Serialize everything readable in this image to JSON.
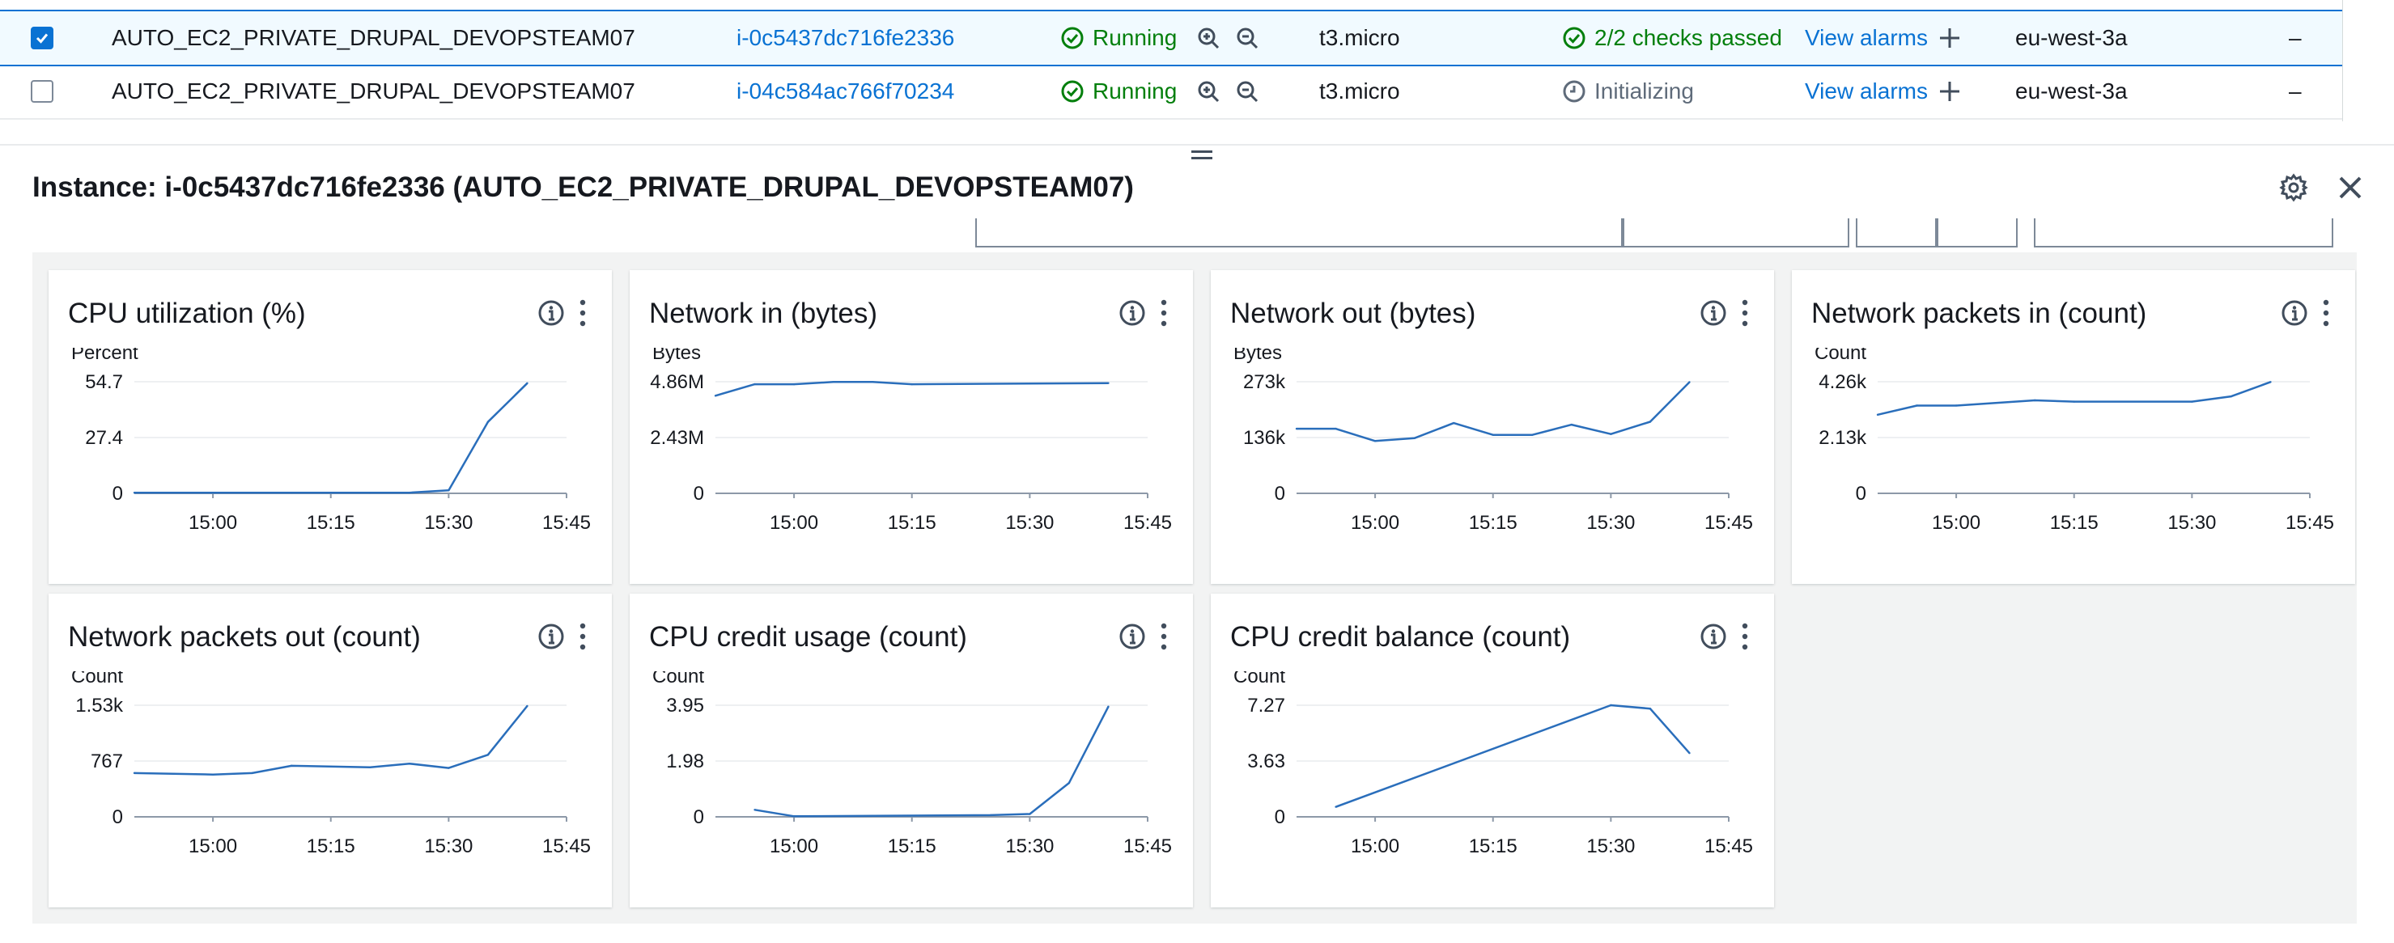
{
  "instances": [
    {
      "selected": true,
      "name": "AUTO_EC2_PRIVATE_DRUPAL_DEVOPSTEAM07",
      "id": "i-0c5437dc716fe2336",
      "state": "Running",
      "type": "t3.micro",
      "status_check": "2/2 checks passed",
      "status_kind": "ok",
      "alarm": "View alarms",
      "az": "eu-west-3a",
      "ip": "–"
    },
    {
      "selected": false,
      "name": "AUTO_EC2_PRIVATE_DRUPAL_DEVOPSTEAM07",
      "id": "i-04c584ac766f70234",
      "state": "Running",
      "type": "t3.micro",
      "status_check": "Initializing",
      "status_kind": "init",
      "alarm": "View alarms",
      "az": "eu-west-3a",
      "ip": "–"
    }
  ],
  "panel": {
    "title": "Instance: i-0c5437dc716fe2336 (AUTO_EC2_PRIVATE_DRUPAL_DEVOPSTEAM07)",
    "icons": [
      "gear-icon",
      "close-icon",
      "info-icon",
      "more-vertical-icon",
      "zoom-in-icon",
      "zoom-out-icon",
      "check-circle-icon",
      "clock-icon",
      "plus-icon"
    ]
  },
  "colors": {
    "link": "#0972d3",
    "success": "#037f0c",
    "line": "#2a6ebb",
    "pending": "#5f6b7a"
  },
  "chart_data": [
    {
      "type": "line",
      "title": "CPU utilization (%)",
      "ylabel": "Percent",
      "xticks": [
        "15:00",
        "15:15",
        "15:30",
        "15:45"
      ],
      "yticks": [
        "0",
        "27.4",
        "54.7"
      ],
      "ylim": [
        0,
        54.7
      ],
      "x": [
        "14:50",
        "15:00",
        "15:10",
        "15:20",
        "15:25",
        "15:30",
        "15:35",
        "15:40"
      ],
      "values": [
        0.3,
        0.3,
        0.3,
        0.3,
        0.3,
        1.5,
        35,
        54
      ]
    },
    {
      "type": "line",
      "title": "Network in (bytes)",
      "ylabel": "Bytes",
      "xticks": [
        "15:00",
        "15:15",
        "15:30",
        "15:45"
      ],
      "yticks": [
        "0",
        "2.43M",
        "4.86M"
      ],
      "ylim": [
        0,
        4.86
      ],
      "x": [
        "14:50",
        "14:55",
        "15:00",
        "15:05",
        "15:10",
        "15:15",
        "15:40"
      ],
      "values": [
        4.25,
        4.75,
        4.75,
        4.85,
        4.85,
        4.75,
        4.8
      ]
    },
    {
      "type": "line",
      "title": "Network out (bytes)",
      "ylabel": "Bytes",
      "xticks": [
        "15:00",
        "15:15",
        "15:30",
        "15:45"
      ],
      "yticks": [
        "0",
        "136k",
        "273k"
      ],
      "ylim": [
        0,
        273
      ],
      "x": [
        "14:50",
        "14:55",
        "15:00",
        "15:05",
        "15:10",
        "15:15",
        "15:20",
        "15:25",
        "15:30",
        "15:35",
        "15:40"
      ],
      "values": [
        158,
        158,
        128,
        135,
        172,
        143,
        143,
        168,
        145,
        175,
        272
      ]
    },
    {
      "type": "line",
      "title": "Network packets in (count)",
      "ylabel": "Count",
      "xticks": [
        "15:00",
        "15:15",
        "15:30",
        "15:45"
      ],
      "yticks": [
        "0",
        "2.13k",
        "4.26k"
      ],
      "ylim": [
        0,
        4.26
      ],
      "x": [
        "14:50",
        "14:55",
        "15:00",
        "15:10",
        "15:15",
        "15:30",
        "15:35",
        "15:40"
      ],
      "values": [
        3.0,
        3.35,
        3.35,
        3.55,
        3.5,
        3.5,
        3.7,
        4.25
      ]
    },
    {
      "type": "line",
      "title": "Network packets out (count)",
      "ylabel": "Count",
      "xticks": [
        "15:00",
        "15:15",
        "15:30",
        "15:45"
      ],
      "yticks": [
        "0",
        "767",
        "1.53k"
      ],
      "ylim": [
        0,
        1.53
      ],
      "x": [
        "14:50",
        "15:00",
        "15:05",
        "15:10",
        "15:20",
        "15:25",
        "15:30",
        "15:35",
        "15:40"
      ],
      "values": [
        0.6,
        0.58,
        0.6,
        0.7,
        0.68,
        0.73,
        0.67,
        0.85,
        1.52
      ]
    },
    {
      "type": "line",
      "title": "CPU credit usage (count)",
      "ylabel": "Count",
      "xticks": [
        "15:00",
        "15:15",
        "15:30",
        "15:45"
      ],
      "yticks": [
        "0",
        "1.98",
        "3.95"
      ],
      "ylim": [
        0,
        3.95
      ],
      "x": [
        "14:55",
        "15:00",
        "15:25",
        "15:30",
        "15:35",
        "15:40"
      ],
      "values": [
        0.25,
        0.02,
        0.06,
        0.1,
        1.2,
        3.9
      ]
    },
    {
      "type": "line",
      "title": "CPU credit balance (count)",
      "ylabel": "Count",
      "xticks": [
        "15:00",
        "15:15",
        "15:30",
        "15:45"
      ],
      "yticks": [
        "0",
        "3.63",
        "7.27"
      ],
      "ylim": [
        0,
        7.27
      ],
      "x": [
        "14:55",
        "15:30",
        "15:35",
        "15:40"
      ],
      "values": [
        0.65,
        7.27,
        7.05,
        4.15
      ]
    }
  ]
}
